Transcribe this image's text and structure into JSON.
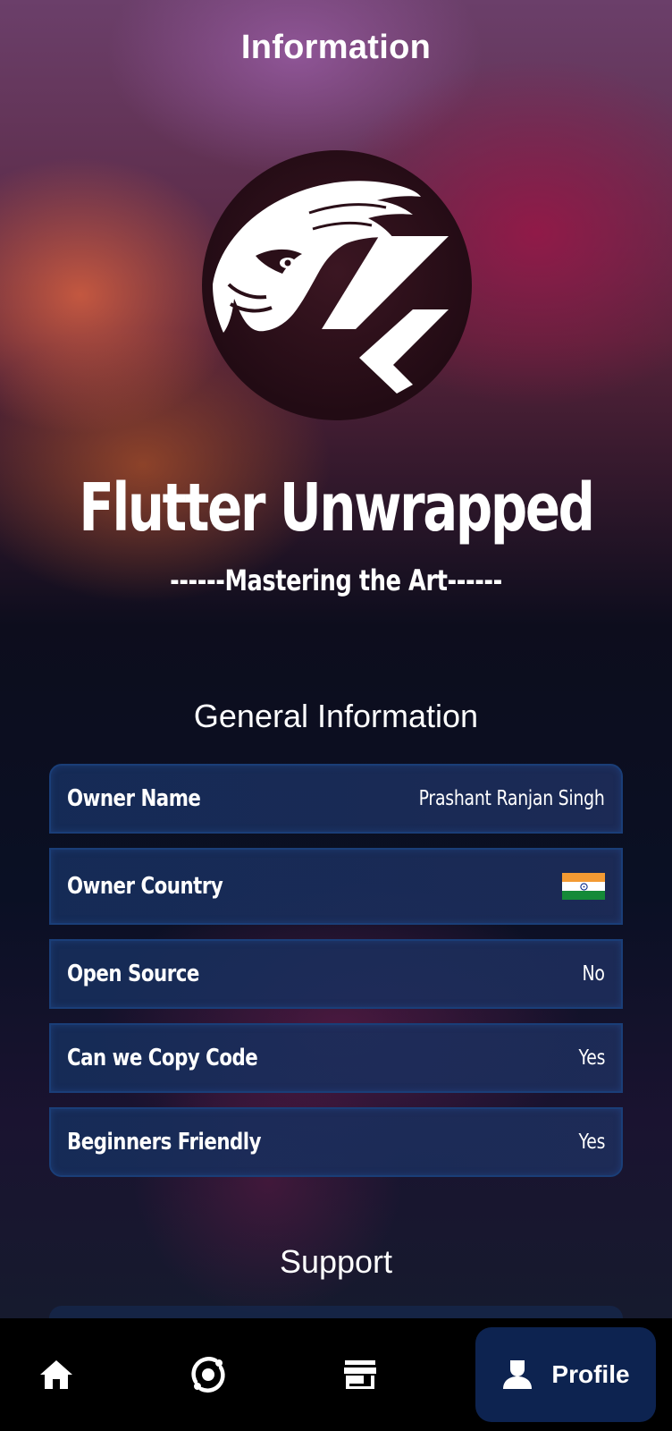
{
  "header": {
    "title": "Information"
  },
  "app": {
    "name": "Flutter Unwrapped",
    "tagline": "------Mastering the Art------",
    "logo_icon": "eagle-flutter-logo"
  },
  "general": {
    "title": "General Information",
    "rows": [
      {
        "label": "Owner Name",
        "value": "Prashant Ranjan Singh"
      },
      {
        "label": "Owner Country",
        "value_icon": "india-flag-icon"
      },
      {
        "label": "Open Source",
        "value": "No"
      },
      {
        "label": "Can we Copy Code",
        "value": "Yes"
      },
      {
        "label": "Beginners Friendly",
        "value": "Yes"
      }
    ]
  },
  "support": {
    "title": "Support"
  },
  "nav": {
    "items": [
      {
        "icon": "home-icon"
      },
      {
        "icon": "explore-icon"
      },
      {
        "icon": "store-icon"
      },
      {
        "icon": "person-icon",
        "label": "Profile",
        "active": true
      }
    ]
  },
  "colors": {
    "card_bg": "#162d5a",
    "card_border": "#1a3e78",
    "nav_bg": "#000000",
    "nav_active_bg": "#0d2350",
    "flag_saffron": "#f39a33",
    "flag_white": "#ffffff",
    "flag_green": "#148a38",
    "flag_chakra": "#0a2a8a"
  }
}
